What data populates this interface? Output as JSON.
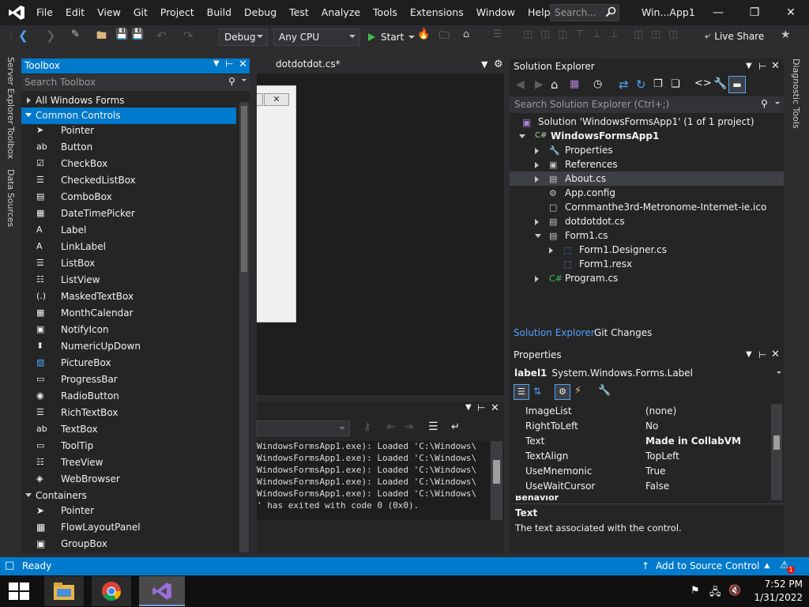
{
  "menubar": {
    "items": [
      "File",
      "Edit",
      "View",
      "Git",
      "Project",
      "Build",
      "Debug",
      "Test",
      "Analyze",
      "Tools",
      "Extensions",
      "Window",
      "Help"
    ],
    "search_placeholder": "Search...",
    "window_title": "Win...App1"
  },
  "toolbar": {
    "config": "Debug",
    "platform": "Any CPU",
    "start_label": "Start",
    "live_share": "Live Share"
  },
  "side_tabs": {
    "left": [
      "Server Explorer",
      "Toolbox",
      "Data Sources"
    ],
    "right": "Diagnostic Tools"
  },
  "toolbox": {
    "title": "Toolbox",
    "search_placeholder": "Search Toolbox",
    "cat_all": "All Windows Forms",
    "cat_common": "Common Controls",
    "common_items": [
      "Pointer",
      "Button",
      "CheckBox",
      "CheckedListBox",
      "ComboBox",
      "DateTimePicker",
      "Label",
      "LinkLabel",
      "ListBox",
      "ListView",
      "MaskedTextBox",
      "MonthCalendar",
      "NotifyIcon",
      "NumericUpDown",
      "PictureBox",
      "ProgressBar",
      "RadioButton",
      "RichTextBox",
      "TextBox",
      "ToolTip",
      "TreeView",
      "WebBrowser"
    ],
    "cat_containers": "Containers",
    "container_items": [
      "Pointer",
      "FlowLayoutPanel",
      "GroupBox"
    ]
  },
  "editor": {
    "tab_label": "dotdotdot.cs*"
  },
  "output": {
    "lines": [
      "WindowsFormsApp1.exe): Loaded 'C:\\Windows\\",
      "WindowsFormsApp1.exe): Loaded 'C:\\Windows\\",
      "WindowsFormsApp1.exe): Loaded 'C:\\Windows\\",
      "WindowsFormsApp1.exe): Loaded 'C:\\Windows\\",
      "WindowsFormsApp1.exe): Loaded 'C:\\Windows\\",
      "' has exited with code 0 (0x0)."
    ]
  },
  "solution_explorer": {
    "title": "Solution Explorer",
    "search_placeholder": "Search Solution Explorer (Ctrl+;)",
    "solution": "Solution 'WindowsFormsApp1' (1 of 1 project)",
    "project": "WindowsFormsApp1",
    "nodes": [
      "Properties",
      "References",
      "About.cs",
      "App.config",
      "Cornmanthe3rd-Metronome-Internet-ie.ico",
      "dotdotdot.cs",
      "Form1.cs",
      "Form1.Designer.cs",
      "Form1.resx",
      "Program.cs"
    ],
    "tab_solution": "Solution Explorer",
    "tab_git": "Git Changes"
  },
  "properties": {
    "title": "Properties",
    "object_name": "label1",
    "object_type": "System.Windows.Forms.Label",
    "rows": [
      {
        "name": "ImageList",
        "value": "(none)"
      },
      {
        "name": "RightToLeft",
        "value": "No"
      },
      {
        "name": "Text",
        "value": "Made in CollabVM"
      },
      {
        "name": "TextAlign",
        "value": "TopLeft"
      },
      {
        "name": "UseMnemonic",
        "value": "True"
      },
      {
        "name": "UseWaitCursor",
        "value": "False"
      }
    ],
    "next_category": "Behavior",
    "desc_title": "Text",
    "desc_text": "The text associated with the control."
  },
  "statusbar": {
    "ready": "Ready",
    "source_control": "Add to Source Control",
    "notifications": "1"
  },
  "taskbar": {
    "time": "7:52 PM",
    "date": "1/31/2022"
  }
}
